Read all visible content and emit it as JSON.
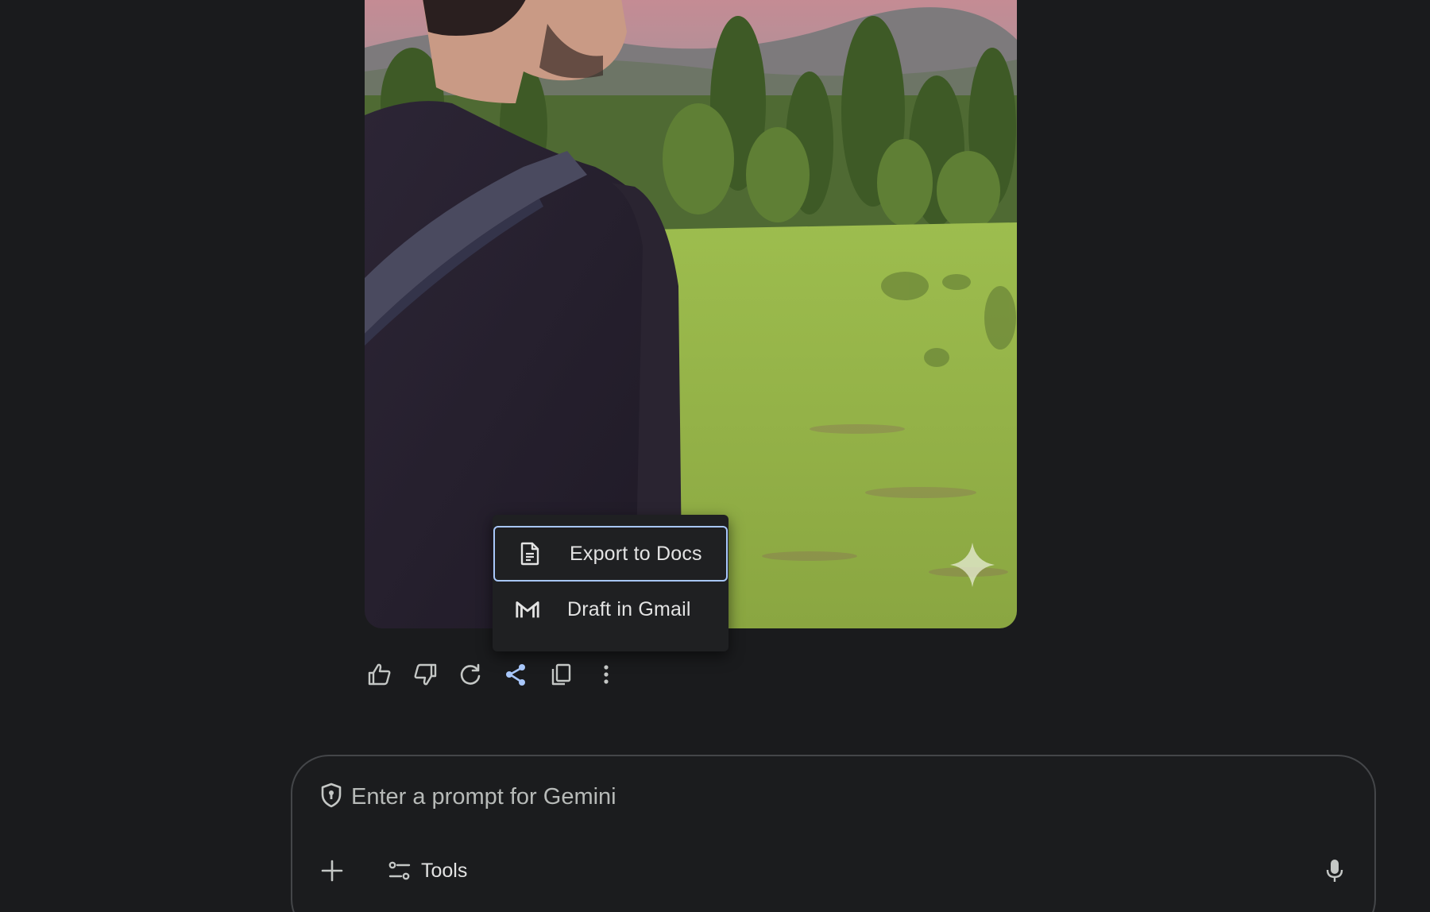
{
  "image": {
    "alt_icon": "gemini-sparkle-watermark-icon"
  },
  "share_menu": {
    "items": [
      {
        "label": "Export to Docs",
        "icon": "docs-icon"
      },
      {
        "label": "Draft in Gmail",
        "icon": "gmail-icon"
      }
    ]
  },
  "actions": [
    {
      "name": "thumbs-up",
      "icon": "thumb-up-icon"
    },
    {
      "name": "thumbs-down",
      "icon": "thumb-down-icon"
    },
    {
      "name": "regenerate",
      "icon": "refresh-icon"
    },
    {
      "name": "share",
      "icon": "share-icon",
      "active": true
    },
    {
      "name": "copy",
      "icon": "copy-icon"
    },
    {
      "name": "more",
      "icon": "more-vert-icon"
    }
  ],
  "prompt": {
    "placeholder": "Enter a prompt for Gemini",
    "tools_label": "Tools"
  },
  "colors": {
    "background": "#1a1b1d",
    "text": "#e3e3e3",
    "accent": "#a8c7fa",
    "border": "#444649"
  }
}
